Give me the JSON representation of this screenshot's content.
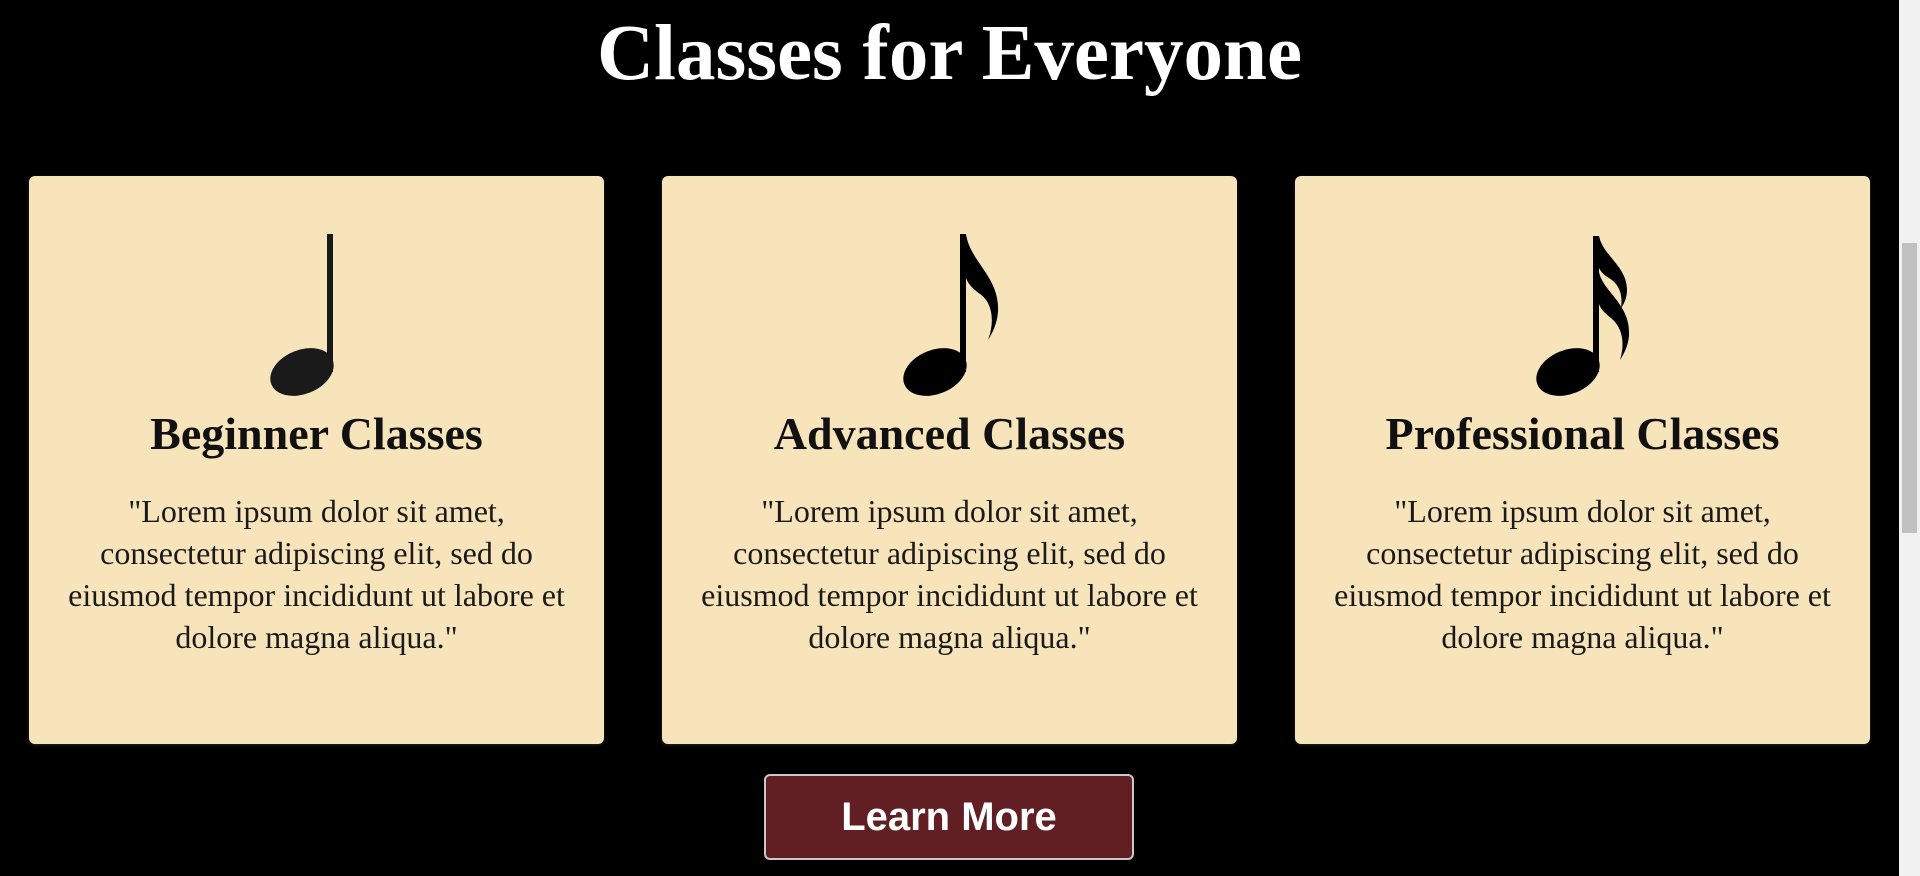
{
  "section": {
    "title": "Classes for Everyone"
  },
  "cards": [
    {
      "icon": "quarter-note-icon",
      "title": "Beginner Classes",
      "text": "\"Lorem ipsum dolor sit amet, consectetur adipiscing elit, sed do eiusmod tempor incididunt ut labore et dolore magna aliqua.\""
    },
    {
      "icon": "eighth-note-icon",
      "title": "Advanced Classes",
      "text": "\"Lorem ipsum dolor sit amet, consectetur adipiscing elit, sed do eiusmod tempor incididunt ut labore et dolore magna aliqua.\""
    },
    {
      "icon": "sixteenth-note-icon",
      "title": "Professional Classes",
      "text": "\"Lorem ipsum dolor sit amet, consectetur adipiscing elit, sed do eiusmod tempor incididunt ut labore et dolore magna aliqua.\""
    }
  ],
  "cta": {
    "label": "Learn More"
  },
  "colors": {
    "background": "#000000",
    "card": "#f8e4bb",
    "button": "#621f23",
    "button_border": "#c9c9c9"
  }
}
